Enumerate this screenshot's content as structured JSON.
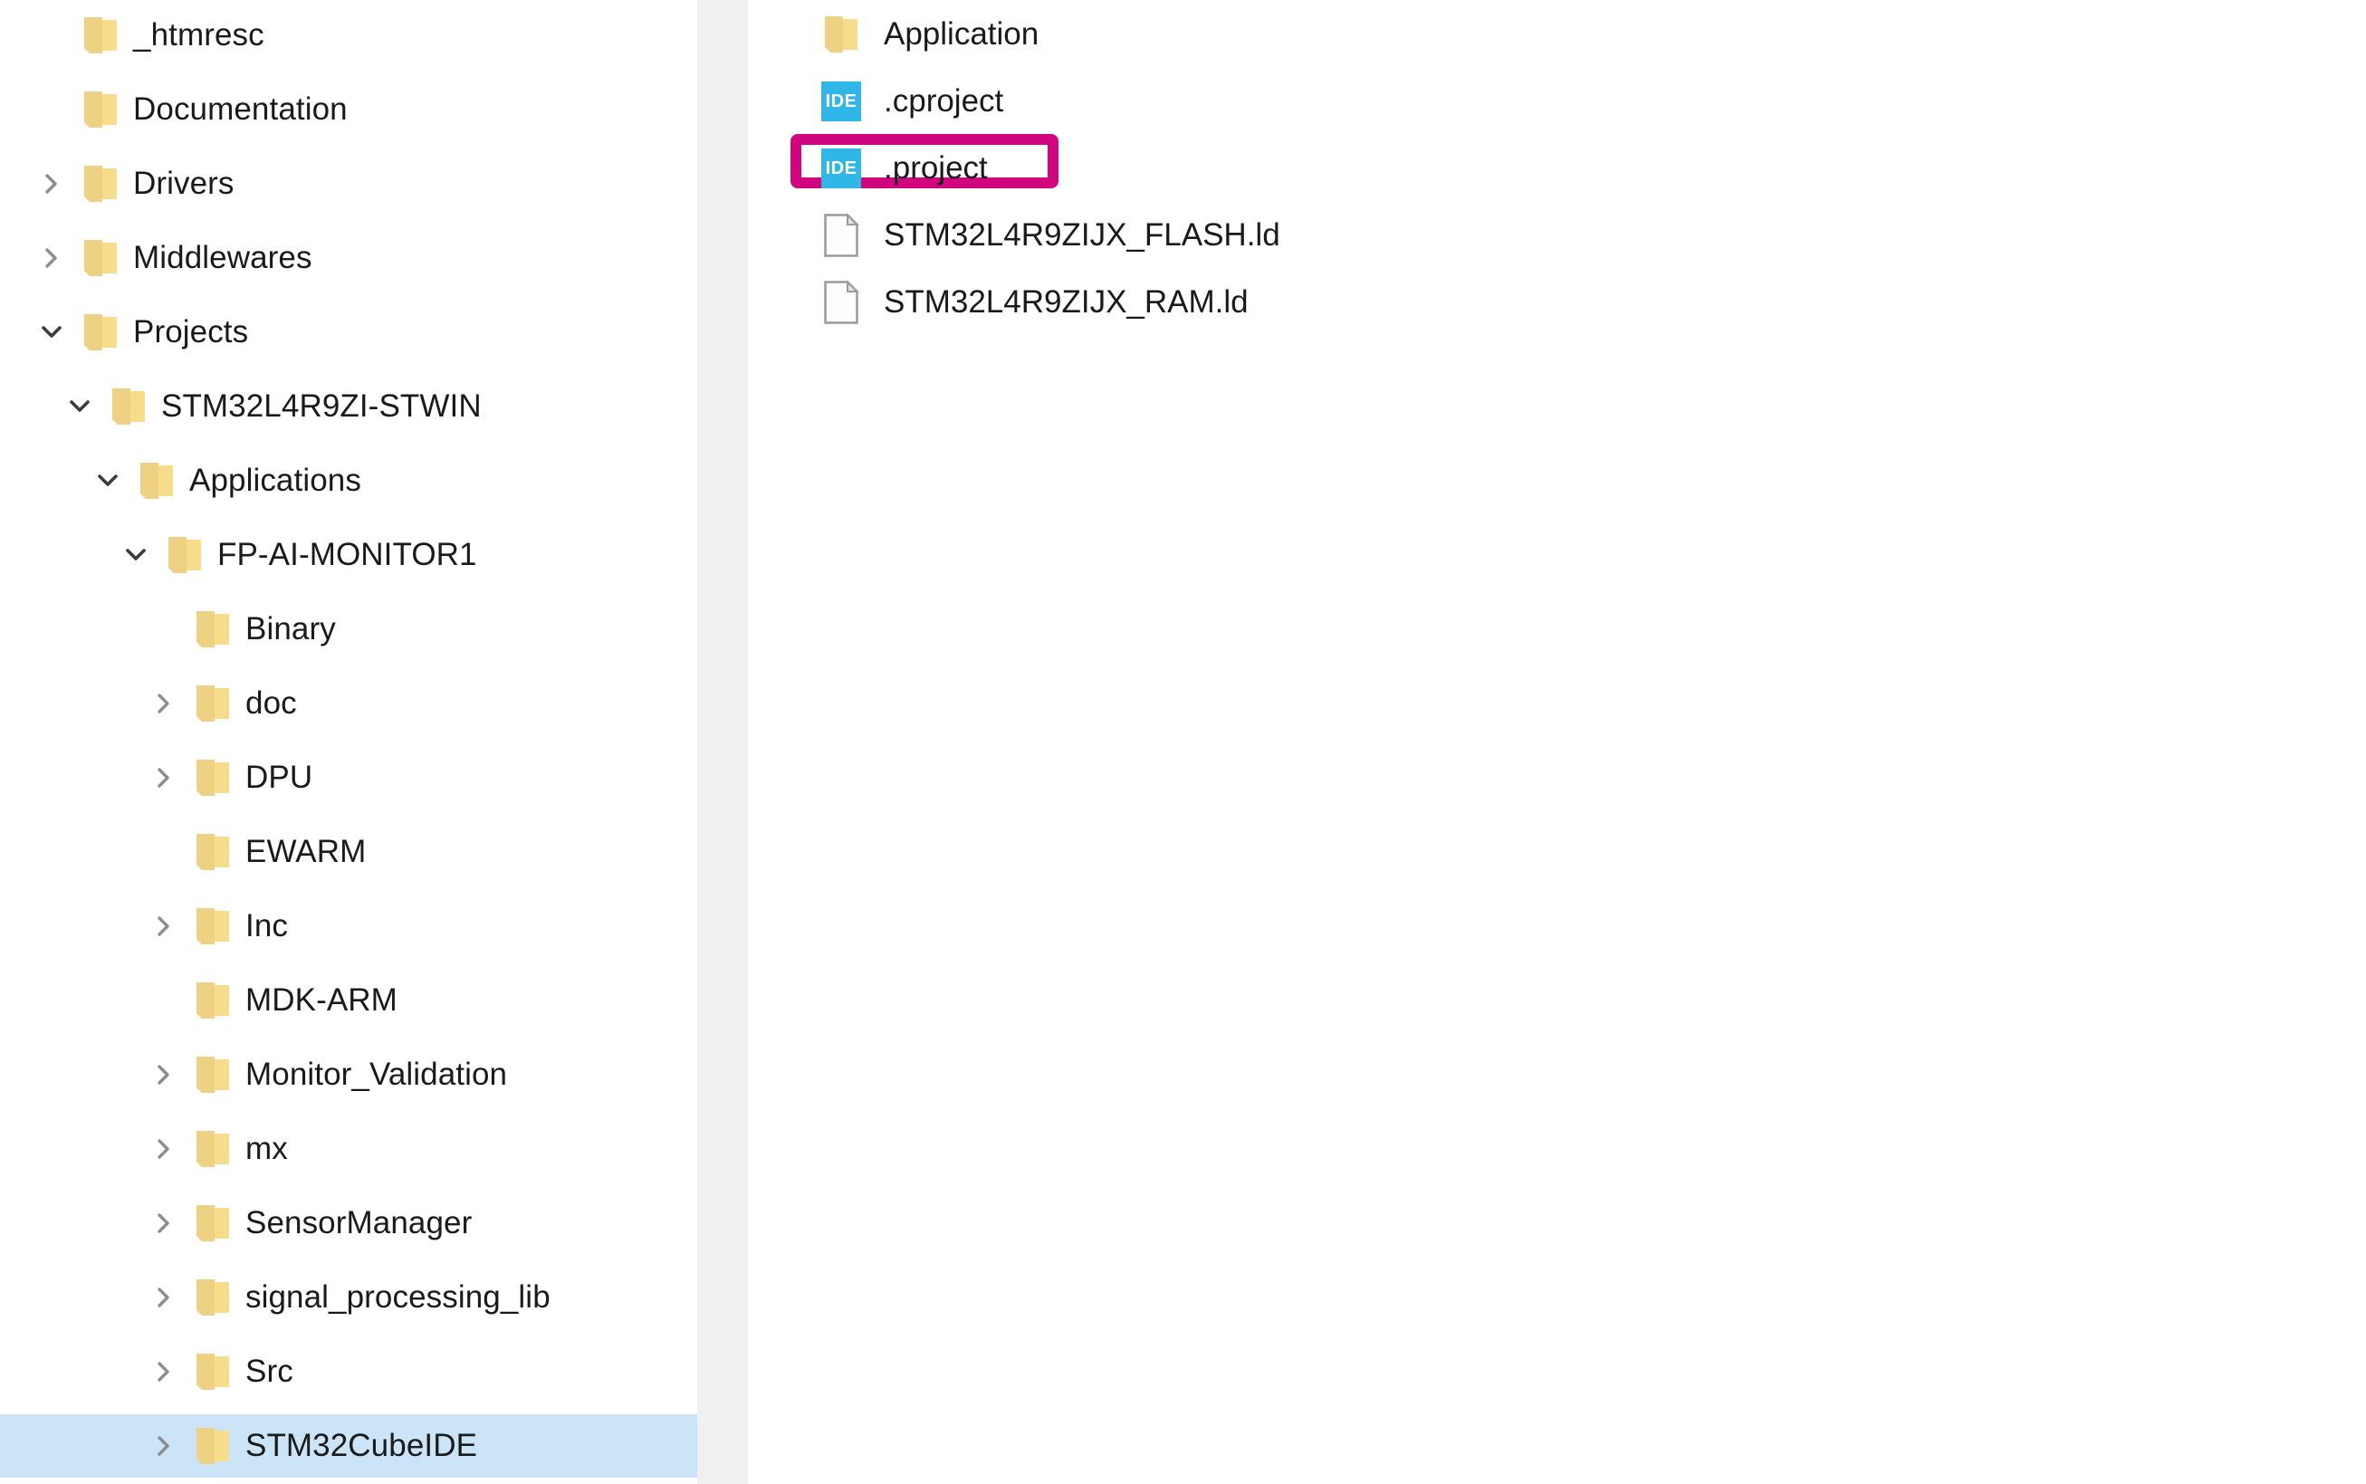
{
  "window": {
    "type": "file-explorer",
    "background": "#ffffff",
    "selection_color": "#cce4f7",
    "annotation_color": "#d1067f",
    "folder_icon_color": "#f2d07a",
    "ide_badge_color": "#30b7e8",
    "text_color": "#1a1a1a"
  },
  "tree": {
    "items": [
      {
        "label": "_htmresc",
        "depth": 1,
        "twisty": "none",
        "icon": "folder-icon",
        "selected": false
      },
      {
        "label": "Documentation",
        "depth": 1,
        "twisty": "none",
        "icon": "folder-icon",
        "selected": false
      },
      {
        "label": "Drivers",
        "depth": 1,
        "twisty": "collapsed",
        "icon": "folder-icon",
        "selected": false
      },
      {
        "label": "Middlewares",
        "depth": 1,
        "twisty": "collapsed",
        "icon": "folder-icon",
        "selected": false
      },
      {
        "label": "Projects",
        "depth": 1,
        "twisty": "expanded",
        "icon": "folder-icon",
        "selected": false
      },
      {
        "label": "STM32L4R9ZI-STWIN",
        "depth": 2,
        "twisty": "expanded",
        "icon": "folder-icon",
        "selected": false
      },
      {
        "label": "Applications",
        "depth": 3,
        "twisty": "expanded",
        "icon": "folder-icon",
        "selected": false
      },
      {
        "label": "FP-AI-MONITOR1",
        "depth": 4,
        "twisty": "expanded",
        "icon": "folder-icon",
        "selected": false
      },
      {
        "label": "Binary",
        "depth": 5,
        "twisty": "none",
        "icon": "folder-icon",
        "selected": false
      },
      {
        "label": "doc",
        "depth": 5,
        "twisty": "collapsed",
        "icon": "folder-icon",
        "selected": false
      },
      {
        "label": "DPU",
        "depth": 5,
        "twisty": "collapsed",
        "icon": "folder-icon",
        "selected": false
      },
      {
        "label": "EWARM",
        "depth": 5,
        "twisty": "none",
        "icon": "folder-icon",
        "selected": false
      },
      {
        "label": "Inc",
        "depth": 5,
        "twisty": "collapsed",
        "icon": "folder-icon",
        "selected": false
      },
      {
        "label": "MDK-ARM",
        "depth": 5,
        "twisty": "none",
        "icon": "folder-icon",
        "selected": false
      },
      {
        "label": "Monitor_Validation",
        "depth": 5,
        "twisty": "collapsed",
        "icon": "folder-icon",
        "selected": false
      },
      {
        "label": "mx",
        "depth": 5,
        "twisty": "collapsed",
        "icon": "folder-icon",
        "selected": false
      },
      {
        "label": "SensorManager",
        "depth": 5,
        "twisty": "collapsed",
        "icon": "folder-icon",
        "selected": false
      },
      {
        "label": "signal_processing_lib",
        "depth": 5,
        "twisty": "collapsed",
        "icon": "folder-icon",
        "selected": false
      },
      {
        "label": "Src",
        "depth": 5,
        "twisty": "collapsed",
        "icon": "folder-icon",
        "selected": false
      },
      {
        "label": "STM32CubeIDE",
        "depth": 5,
        "twisty": "collapsed",
        "icon": "folder-icon",
        "selected": true
      }
    ]
  },
  "file_list": {
    "items": [
      {
        "label": "Application",
        "icon": "folder-icon",
        "annotated": false
      },
      {
        "label": ".cproject",
        "icon": "ide-file-icon",
        "annotated": false
      },
      {
        "label": ".project",
        "icon": "ide-file-icon",
        "annotated": true
      },
      {
        "label": "STM32L4R9ZIJX_FLASH.ld",
        "icon": "document-icon",
        "annotated": false
      },
      {
        "label": "STM32L4R9ZIJX_RAM.ld",
        "icon": "document-icon",
        "annotated": false
      }
    ]
  },
  "icons": {
    "ide_badge_text": "IDE"
  }
}
